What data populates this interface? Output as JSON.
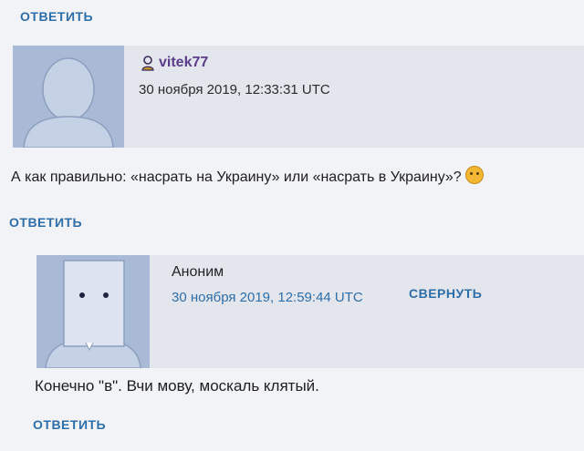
{
  "top_reply": {
    "label": "ОТВЕТИТЬ"
  },
  "comment1": {
    "author": "vitek77",
    "timestamp": "30 ноября 2019, 12:33:31 UTC",
    "text": "А как правильно: «насрать на Украину» или «насрать в Украину»?",
    "emoji": "thinking-face-icon",
    "reply_label": "ОТВЕТИТЬ"
  },
  "comment2": {
    "author": "Аноним",
    "timestamp": "30 ноября 2019, 12:59:44 UTC",
    "collapse_label": "СВЕРНУТЬ",
    "text": "Конечно \"в\". Вчи мову, москаль клятый.",
    "reply_label": "ОТВЕТИТЬ"
  },
  "colors": {
    "link": "#2e6ea8",
    "author_link": "#5a3c8a",
    "avatar_bg": "#a9bad6",
    "header_bg": "#e3e6ec"
  }
}
